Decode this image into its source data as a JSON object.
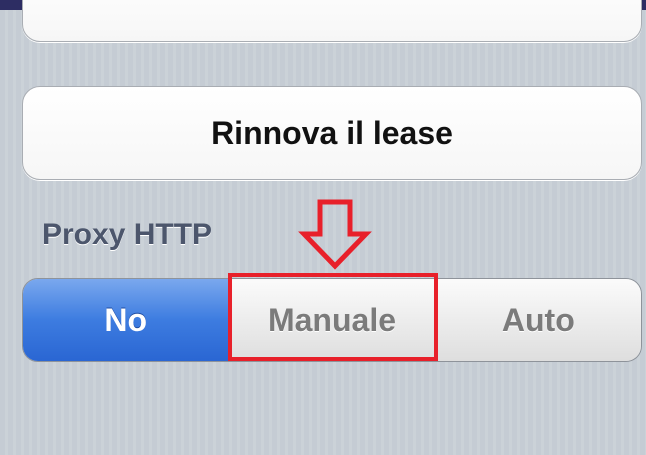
{
  "renew_button": {
    "label": "Rinnova il lease"
  },
  "proxy_section": {
    "header": "Proxy HTTP",
    "segments": [
      {
        "label": "No",
        "selected": true
      },
      {
        "label": "Manuale",
        "selected": false
      },
      {
        "label": "Auto",
        "selected": false
      }
    ]
  },
  "annotation": {
    "highlight_color": "#e8202a",
    "highlighted_segment": "Manuale"
  },
  "colors": {
    "selected_segment": "#3d7ce0",
    "section_header": "#4c566c",
    "background": "#c5ccd4"
  }
}
